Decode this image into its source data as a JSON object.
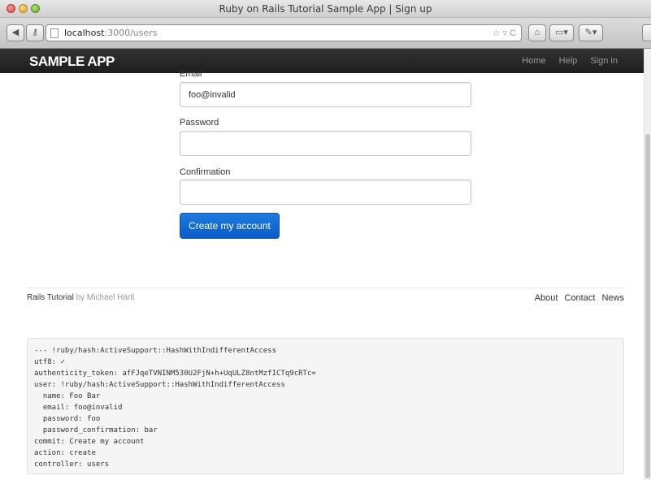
{
  "window": {
    "title": "Ruby on Rails Tutorial Sample App | Sign up"
  },
  "browser": {
    "url_host": "localhost",
    "url_rest": ":3000/users",
    "url_right": "☆ ▿ C"
  },
  "navbar": {
    "brand": "SAMPLE APP",
    "links": [
      "Home",
      "Help",
      "Sign in"
    ]
  },
  "form": {
    "email_label": "Email",
    "email_value": "foo@invalid",
    "password_label": "Password",
    "password_value": "",
    "confirmation_label": "Confirmation",
    "confirmation_value": "",
    "submit_label": "Create my account"
  },
  "footer": {
    "left_link": "Rails Tutorial",
    "left_rest": " by Michael Hartl",
    "links": [
      "About",
      "Contact",
      "News"
    ]
  },
  "debug": {
    "lines": [
      "--- !ruby/hash:ActiveSupport::HashWithIndifferentAccess",
      "utf8: ✓",
      "authenticity_token: afFJqeTVNINM530U2FjN+h+UqULZ8ntMzfICTq9cRTc=",
      "user: !ruby/hash:ActiveSupport::HashWithIndifferentAccess",
      "  name: Foo Bar",
      "  email: foo@invalid",
      "  password: foo",
      "  password_confirmation: bar",
      "commit: Create my account",
      "action: create",
      "controller: users"
    ]
  }
}
